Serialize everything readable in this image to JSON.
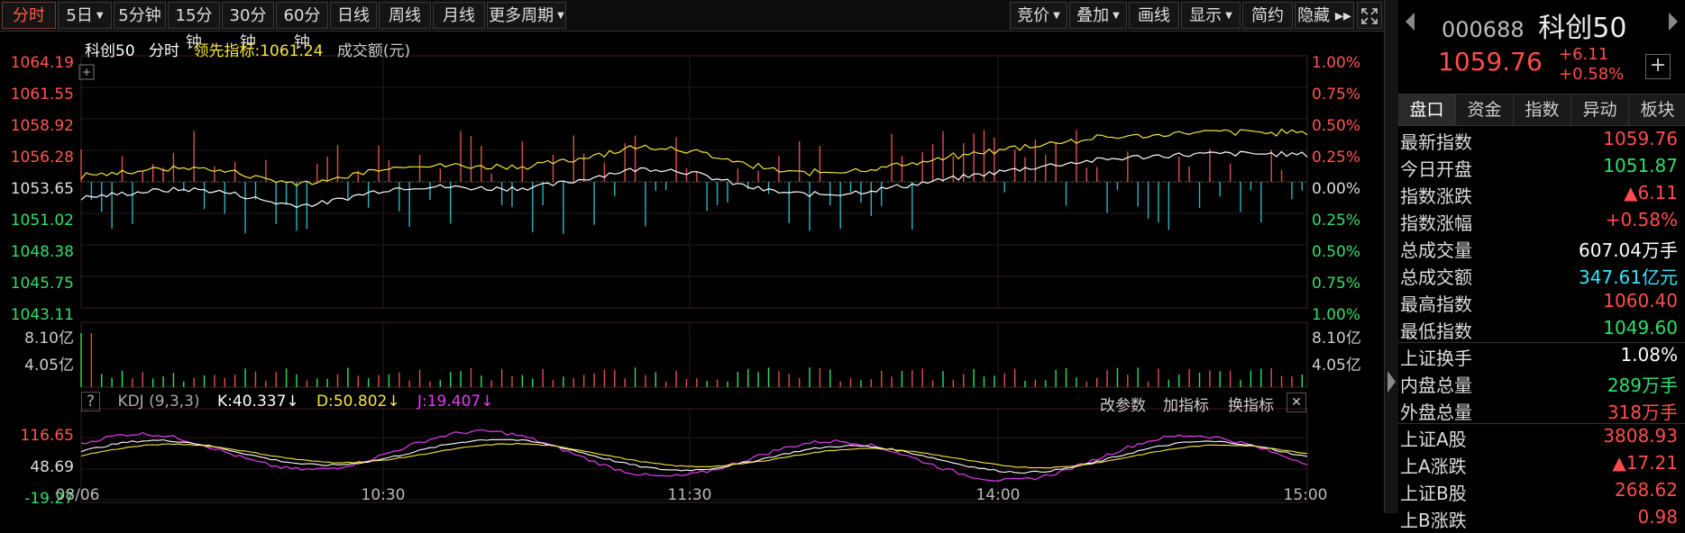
{
  "toolbar": {
    "period_tabs": [
      {
        "label": "分时",
        "active": true
      },
      {
        "label": "5日",
        "dropdown": true
      },
      {
        "label": "5分钟"
      },
      {
        "label": "15分钟"
      },
      {
        "label": "30分钟"
      },
      {
        "label": "60分钟"
      },
      {
        "label": "日线"
      },
      {
        "label": "周线"
      },
      {
        "label": "月线"
      },
      {
        "label": "更多周期",
        "dropdown": true
      }
    ],
    "tools": [
      {
        "label": "竞价",
        "dropdown": true
      },
      {
        "label": "叠加",
        "dropdown": true
      },
      {
        "label": "画线"
      },
      {
        "label": "显示",
        "dropdown": true
      },
      {
        "label": "简约"
      },
      {
        "label": "隐藏 ▸▸"
      }
    ],
    "fullscreen_icon": "expand-icon"
  },
  "legend": {
    "name": "科创50",
    "mode": "分时",
    "leading_label": "领先指标:",
    "leading_value": "1061.24",
    "volume_label": "成交额(元)"
  },
  "price_axis": {
    "left": [
      "1064.19",
      "1061.55",
      "1058.92",
      "1056.28",
      "1053.65",
      "1051.02",
      "1048.38",
      "1045.75",
      "1043.11"
    ],
    "right": [
      "1.00%",
      "0.75%",
      "0.50%",
      "0.25%",
      "0.00%",
      "0.25%",
      "0.50%",
      "0.75%",
      "1.00%"
    ]
  },
  "volume_axis": {
    "top": "8.10亿",
    "mid": "4.05亿"
  },
  "kdj": {
    "help": "?",
    "title": "KDJ (9,3,3)",
    "k": "K:40.337↓",
    "d": "D:50.802↓",
    "j": "J:19.407↓",
    "axis": [
      "116.65",
      "48.69",
      "-19.27"
    ],
    "tools": [
      "改参数",
      "加指标",
      "换指标"
    ],
    "close": "✕"
  },
  "time_axis": [
    "08/06",
    "10:30",
    "11:30",
    "14:00",
    "15:00"
  ],
  "colors": {
    "up": "#ff4d4d",
    "down": "#2ee06a",
    "price_line": "#ffffff",
    "leading_line": "#f5e63a",
    "volume_bar_up": "#e05050",
    "volume_bar_down": "#2ab7c0",
    "kdj_j": "#e23cf0"
  },
  "panel": {
    "code": "000688",
    "name": "科创50",
    "price": "1059.76",
    "change": "+6.11",
    "change_pct": "+0.58%",
    "tabs": [
      "盘口",
      "资金",
      "指数",
      "异动",
      "板块"
    ],
    "rows_a": [
      {
        "k": "最新指数",
        "v": "1059.76",
        "c": "red"
      },
      {
        "k": "今日开盘",
        "v": "1051.87",
        "c": "green"
      },
      {
        "k": "指数涨跌",
        "v": "▲6.11",
        "c": "red"
      },
      {
        "k": "指数涨幅",
        "v": "+0.58%",
        "c": "red"
      },
      {
        "k": "总成交量",
        "v": "607.04万手",
        "c": "white"
      },
      {
        "k": "总成交额",
        "v": "347.61亿元",
        "c": "cyan"
      },
      {
        "k": "最高指数",
        "v": "1060.40",
        "c": "red"
      },
      {
        "k": "最低指数",
        "v": "1049.60",
        "c": "green"
      }
    ],
    "rows_b": [
      {
        "k": "上证换手",
        "v": "1.08%",
        "c": "white"
      },
      {
        "k": "内盘总量",
        "v": "289万手",
        "c": "green"
      },
      {
        "k": "外盘总量",
        "v": "318万手",
        "c": "red"
      }
    ],
    "rows_c": [
      {
        "k": "上证A股",
        "v": "3808.93",
        "c": "red"
      },
      {
        "k": "上A涨跌",
        "v": "▲17.21",
        "c": "red"
      },
      {
        "k": "上证B股",
        "v": "268.62",
        "c": "red"
      },
      {
        "k": "上B涨跌",
        "v": "0.98",
        "c": "red"
      }
    ]
  }
}
